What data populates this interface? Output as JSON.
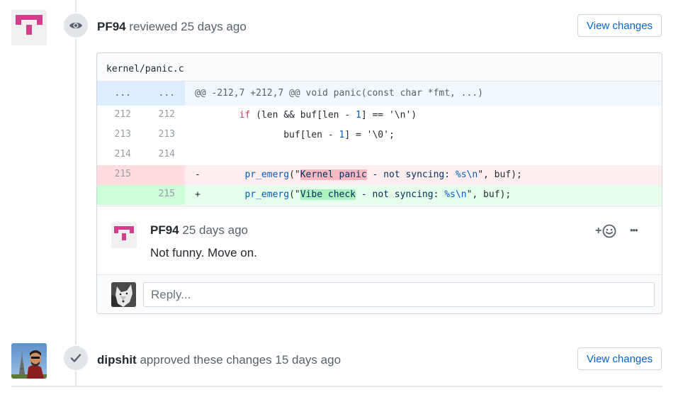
{
  "events": [
    {
      "author": "PF94",
      "action": "reviewed",
      "time": "25 days ago",
      "badge_icon": "eye-icon",
      "button_label": "View changes"
    },
    {
      "author": "dipshit",
      "action": "approved these changes",
      "time": "15 days ago",
      "badge_icon": "check-icon",
      "button_label": "View changes"
    }
  ],
  "review": {
    "file_path": "kernel/panic.c",
    "diff": {
      "hunk": {
        "old": "...",
        "new": "...",
        "text": "@@ -212,7 +212,7 @@ void panic(const char *fmt, ...)"
      },
      "context_lines": [
        {
          "old": "212",
          "new": "212",
          "pre": "        ",
          "kw": "if",
          "mid": " (len && buf[len - ",
          "num": "1",
          "post": "] == '\\n')"
        },
        {
          "old": "213",
          "new": "213",
          "pre": "                buf[len - ",
          "num": "1",
          "post": "] = '\\0';"
        },
        {
          "old": "214",
          "new": "214",
          "text": ""
        }
      ],
      "deleted": {
        "old": "215",
        "marker": "-",
        "indent": "        ",
        "fn": "pr_emerg",
        "open": "(\"",
        "changed": "Kernel panic",
        "rest": " - not syncing: ",
        "fmt": "%s\\n",
        "tail": "\", buf);"
      },
      "added": {
        "new": "215",
        "marker": "+",
        "indent": "        ",
        "fn": "pr_emerg",
        "open": "(\"",
        "changed": "Vibe check",
        "rest": " - not syncing: ",
        "fmt": "%s\\n",
        "tail": "\", buf);"
      }
    },
    "comment": {
      "author": "PF94",
      "time": "25 days ago",
      "body": "Not funny. Move on.",
      "reaction_label": "+",
      "more_label": "•••"
    },
    "reply_placeholder": "Reply..."
  },
  "colors": {
    "link": "#0366d6",
    "identicon": "#d03f8c",
    "deleted_bg": "#ffeef0",
    "added_bg": "#e6ffed"
  }
}
